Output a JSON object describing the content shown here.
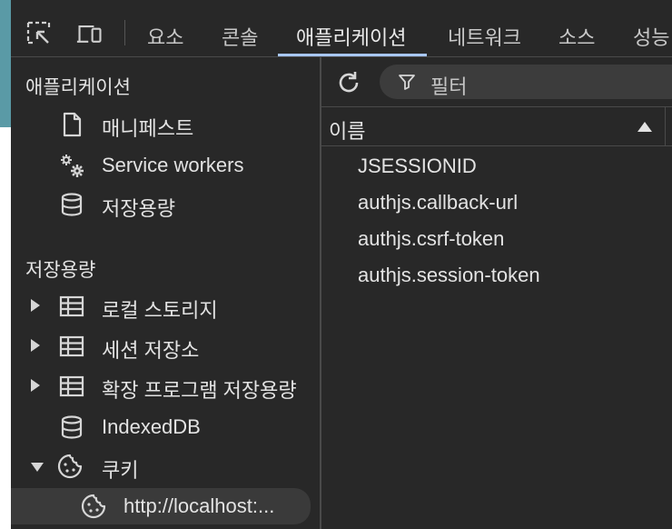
{
  "toolbar": {
    "tools": [
      {
        "icon": "inspect-element-icon"
      },
      {
        "icon": "device-toolbar-icon"
      }
    ],
    "tabs": [
      {
        "label": "요소",
        "active": false
      },
      {
        "label": "콘솔",
        "active": false
      },
      {
        "label": "애플리케이션",
        "active": true
      },
      {
        "label": "네트워크",
        "active": false
      },
      {
        "label": "소스",
        "active": false
      },
      {
        "label": "성능",
        "active": false
      }
    ]
  },
  "sidebar": {
    "app_section": {
      "title": "애플리케이션",
      "items": [
        {
          "label": "매니페스트",
          "icon": "document-icon"
        },
        {
          "label": "Service workers",
          "icon": "gears-icon"
        },
        {
          "label": "저장용량",
          "icon": "database-icon"
        }
      ]
    },
    "storage_section": {
      "title": "저장용량",
      "items": [
        {
          "label": "로컬 스토리지",
          "icon": "table-icon",
          "expand": "collapsed"
        },
        {
          "label": "세션 저장소",
          "icon": "table-icon",
          "expand": "collapsed"
        },
        {
          "label": "확장 프로그램 저장용량",
          "icon": "table-icon",
          "expand": "collapsed"
        },
        {
          "label": "IndexedDB",
          "icon": "database-icon",
          "expand": "none"
        },
        {
          "label": "쿠키",
          "icon": "cookie-icon",
          "expand": "expanded"
        }
      ],
      "cookie_child": {
        "label": "http://localhost:...",
        "icon": "cookie-icon",
        "selected": true
      }
    }
  },
  "main": {
    "refresh_icon": "refresh-icon",
    "filter": {
      "placeholder": "필터",
      "icon": "filter-icon"
    },
    "table": {
      "column_header": "이름",
      "sort": "ascending",
      "rows": [
        "JSESSIONID",
        "authjs.callback-url",
        "authjs.csrf-token",
        "authjs.session-token"
      ]
    }
  },
  "colors": {
    "background": "#282828",
    "active_tab_underline": "#a8c7fa",
    "selected_row": "#3a3a3a",
    "text": "#e3e3e3"
  }
}
